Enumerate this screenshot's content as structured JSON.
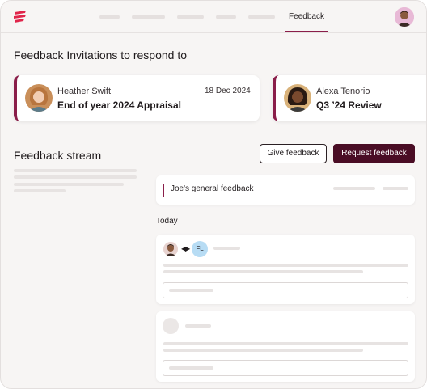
{
  "nav": {
    "active_label": "Feedback",
    "logo_icon": "brand-stripes-icon",
    "accent": "#8a1e4a"
  },
  "invitations": {
    "title": "Feedback Invitations to respond to",
    "cards": [
      {
        "name": "Heather Swift",
        "date": "18 Dec 2024",
        "title": "End of year 2024 Appraisal"
      },
      {
        "name": "Alexa Tenorio",
        "date": "",
        "title": "Q3 ’24 Review"
      }
    ]
  },
  "stream": {
    "title": "Feedback stream",
    "give_button": "Give feedback",
    "request_button": "Request feedback",
    "general_feedback": "Joe's general feedback",
    "today_label": "Today",
    "recipient_initials": "FL",
    "exchange_icon": "exchange-arrows-icon",
    "request_button_color": "#4a0d25"
  }
}
